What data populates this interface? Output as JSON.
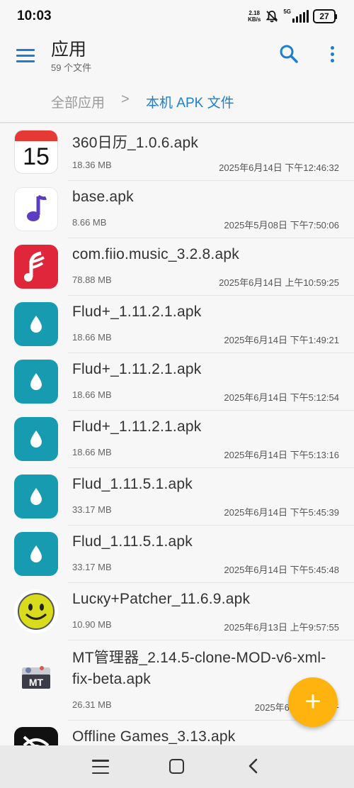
{
  "status_bar": {
    "time": "10:03",
    "speed_value": "2.18",
    "speed_unit": "KB/s",
    "network": "5G",
    "battery": "27"
  },
  "app_bar": {
    "title": "应用",
    "subtitle": "59 个文件",
    "icons": {
      "menu": "hamburger-menu-icon",
      "search": "search-icon",
      "more": "more-vert-icon"
    },
    "accent_color": "#1f7ed1"
  },
  "breadcrumb": {
    "root": "全部应用",
    "separator": ">",
    "current": "本机 APK 文件"
  },
  "files": [
    {
      "name": "360日历_1.0.6.apk",
      "size": "18.36 MB",
      "date": "2025年6月14日 下午12:46:32",
      "icon": "calendar-15-icon",
      "icon_text": "15"
    },
    {
      "name": "base.apk",
      "size": "8.66 MB",
      "date": "2025年5月08日 下午7:50:06",
      "icon": "music-note-icon"
    },
    {
      "name": "com.fiio.music_3.2.8.apk",
      "size": "78.88 MB",
      "date": "2025年6月14日 上午10:59:25",
      "icon": "fiio-music-icon"
    },
    {
      "name": "Flud+_1.11.2.1.apk",
      "size": "18.66 MB",
      "date": "2025年6月14日 下午1:49:21",
      "icon": "flud-drop-icon"
    },
    {
      "name": "Flud+_1.11.2.1.apk",
      "size": "18.66 MB",
      "date": "2025年6月14日 下午5:12:54",
      "icon": "flud-drop-icon"
    },
    {
      "name": "Flud+_1.11.2.1.apk",
      "size": "18.66 MB",
      "date": "2025年6月14日 下午5:13:16",
      "icon": "flud-drop-icon"
    },
    {
      "name": "Flud_1.11.5.1.apk",
      "size": "33.17 MB",
      "date": "2025年6月14日 下午5:45:39",
      "icon": "flud-drop-icon"
    },
    {
      "name": "Flud_1.11.5.1.apk",
      "size": "33.17 MB",
      "date": "2025年6月14日 下午5:45:48",
      "icon": "flud-drop-icon"
    },
    {
      "name": "Lucкy+Patcher_11.6.9.apk",
      "size": "10.90 MB",
      "date": "2025年6月13日 上午9:57:55",
      "icon": "lucky-patcher-smiley-icon"
    },
    {
      "name": "MT管理器_2.14.5-clone-MOD-v6-xml-fix-beta.apk",
      "size": "26.31 MB",
      "date": "2025年6月13日 上午",
      "icon": "mt-manager-icon",
      "icon_text": "MT"
    },
    {
      "name": "Offline Games_3.13.apk",
      "size": "",
      "date": "",
      "icon": "offline-games-icon"
    }
  ],
  "fab": {
    "label": "+",
    "color": "#ffb30f",
    "icon": "add-icon"
  },
  "nav_bar": {
    "icons": [
      "recents-menu-icon",
      "home-icon",
      "back-icon"
    ]
  }
}
